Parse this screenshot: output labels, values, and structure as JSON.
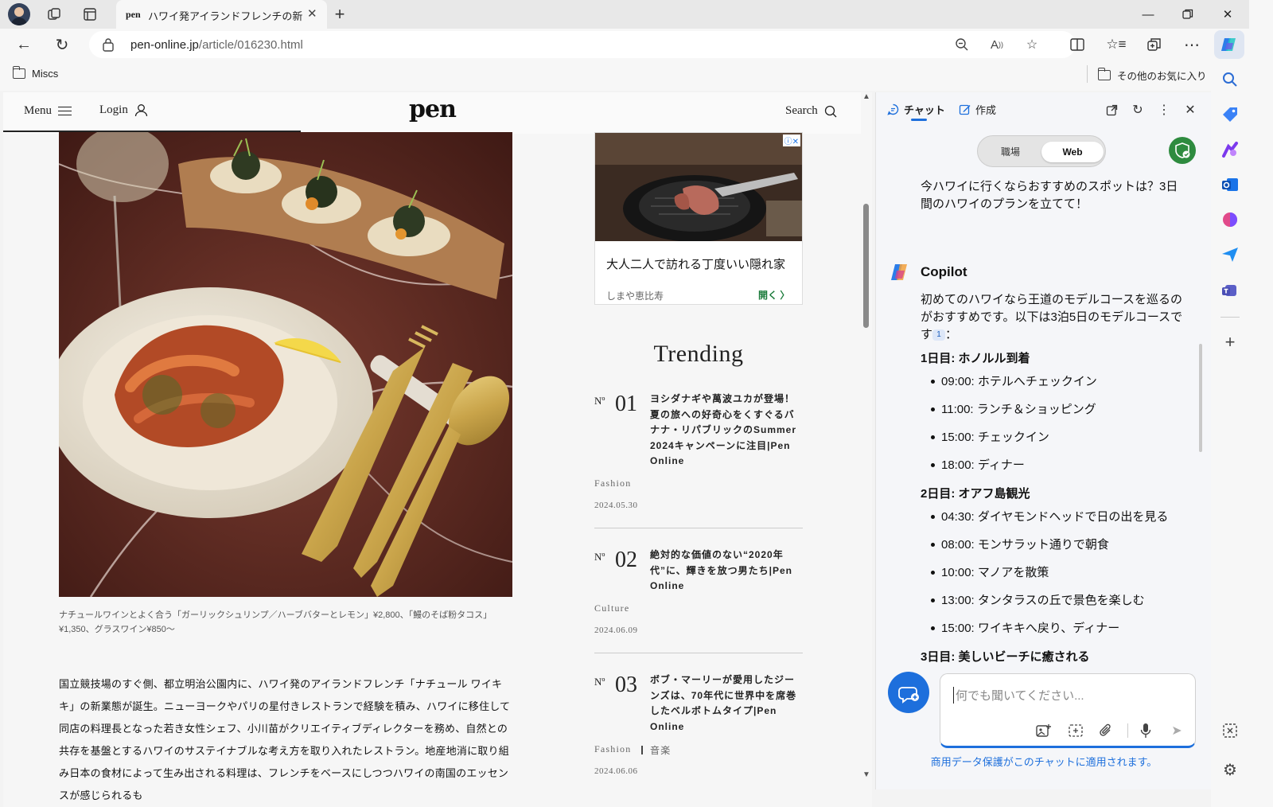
{
  "browser": {
    "tab_title": "ハワイ発アイランドフレンチの新業態「ナチュール ワイキキ」",
    "tab_favicon_text": "pen",
    "url_host": "pen-online.jp",
    "url_path": "/article/016230.html",
    "favorites": {
      "folder": "Miscs",
      "other": "その他のお気に入り"
    }
  },
  "site": {
    "menu": "Menu",
    "login": "Login",
    "logo": "pen",
    "search": "Search"
  },
  "article": {
    "caption": "ナチュールワインとよく合う「ガーリックシュリンプ／ハーブバターとレモン」¥2,800、「鰻のそば粉タコス」¥1,350、グラスワイン¥850〜",
    "body": "国立競技場のすぐ側、都立明治公園内に、ハワイ発のアイランドフレンチ「ナチュール ワイキキ」の新業態が誕生。ニューヨークやパリの星付きレストランで経験を積み、ハワイに移住して同店の料理長となった若き女性シェフ、小川苗がクリエイティブディレクターを務め、自然との共存を基盤とするハワイのサステイナブルな考え方を取り入れたレストラン。地産地消に取り組み日本の食材によって生み出される料理は、フレンチをベースにしつつハワイの南国のエッセンスが感じられるも"
  },
  "ad": {
    "headline": "大人二人で訪れる丁度いい隠れ家",
    "sponsor": "しまや恵比寿",
    "open": "開く"
  },
  "trending": {
    "title": "Trending",
    "no_label": "Nº",
    "items": [
      {
        "num": "01",
        "title": "ヨシダナギや萬波ユカが登場！夏の旅への好奇心をくすぐるバナナ・リパブリックのSummer 2024キャンペーンに注目|Pen Online",
        "category": "Fashion",
        "tag": "",
        "date": "2024.05.30"
      },
      {
        "num": "02",
        "title": "絶対的な価値のない“2020年代”に、輝きを放つ男たち|Pen Online",
        "category": "Culture",
        "tag": "",
        "date": "2024.06.09"
      },
      {
        "num": "03",
        "title": "ボブ・マーリーが愛用したジーンズは、70年代に世界中を席巻したベルボトムタイプ|Pen Online",
        "category": "Fashion",
        "tag": "音楽",
        "date": "2024.06.06"
      }
    ]
  },
  "copilot": {
    "tabs": {
      "chat": "チャット",
      "compose": "作成"
    },
    "mode": {
      "work": "職場",
      "web": "Web"
    },
    "user_question": "今ハワイに行くならおすすめのスポットは？3日間のハワイのプランを立てて！",
    "name": "Copilot",
    "intro": "初めてのハワイなら王道のモデルコースを巡るのがおすすめです。以下は3泊5日のモデルコースです",
    "cite": "1",
    "intro_end": "：",
    "days": [
      {
        "title": "1日目: ホノルル到着",
        "items": [
          "09:00: ホテルへチェックイン",
          "11:00: ランチ＆ショッピング",
          "15:00: チェックイン",
          "18:00: ディナー"
        ]
      },
      {
        "title": "2日目: オアフ島観光",
        "items": [
          "04:30: ダイヤモンドヘッドで日の出を見る",
          "08:00: モンサラット通りで朝食",
          "10:00: マノアを散策",
          "13:00: タンタラスの丘で景色を楽しむ",
          "15:00: ワイキキへ戻り、ディナー"
        ]
      },
      {
        "title": "3日目: 美しいビーチに癒される",
        "items": []
      }
    ],
    "input_placeholder": "何でも聞いてください...",
    "notice": "商用データ保護がこのチャットに適用されます。"
  }
}
